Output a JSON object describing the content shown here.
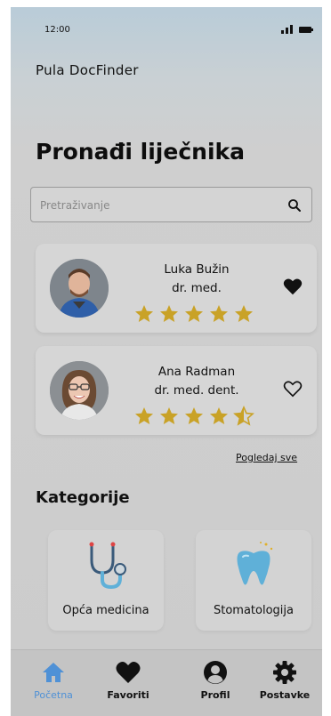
{
  "status_bar": {
    "time": "12:00"
  },
  "app": {
    "title": "Pula DocFinder"
  },
  "page": {
    "heading": "Pronađi liječnika"
  },
  "search": {
    "placeholder": "Pretraživanje"
  },
  "doctors": [
    {
      "name": "Luka Bužin",
      "title": "dr. med.",
      "rating": 5,
      "favorite": true
    },
    {
      "name": "Ana Radman",
      "title": "dr. med. dent.",
      "rating": 4.5,
      "favorite": false
    }
  ],
  "view_all_label": "Pogledaj sve",
  "categories_section": {
    "title": "Kategorije"
  },
  "categories": [
    {
      "label": "Opća medicina",
      "icon": "stethoscope-icon"
    },
    {
      "label": "Stomatologija",
      "icon": "tooth-icon"
    }
  ],
  "bottom_nav": [
    {
      "label": "Početna",
      "icon": "home-icon",
      "active": true
    },
    {
      "label": "Favoriti",
      "icon": "heart-icon",
      "active": false
    },
    {
      "label": "Profil",
      "icon": "user-icon",
      "active": false
    },
    {
      "label": "Postavke",
      "icon": "gear-icon",
      "active": false
    }
  ],
  "colors": {
    "accent": "#4f91d6",
    "star": "#c9a227",
    "tooth": "#5fb0d8"
  }
}
